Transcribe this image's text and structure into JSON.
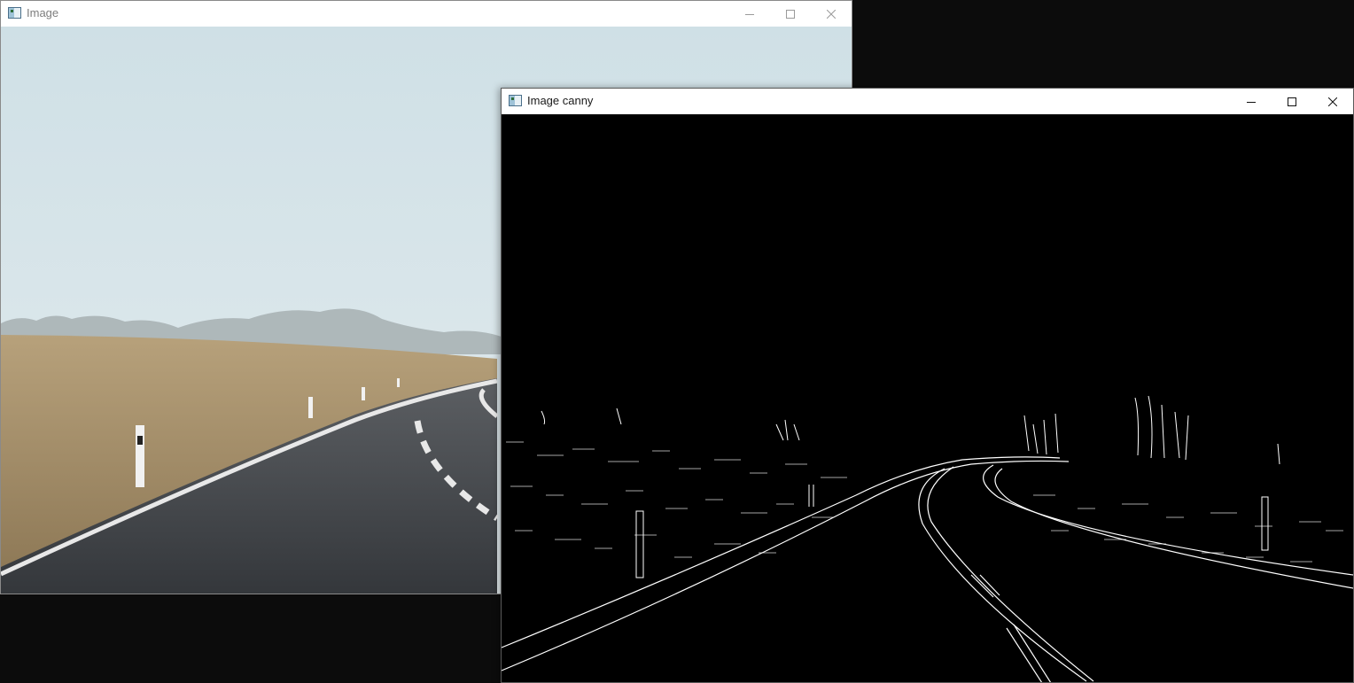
{
  "windows": {
    "original": {
      "title": "Image",
      "icon": "opencv-window-icon",
      "controls": [
        "minimize-icon",
        "maximize-icon",
        "close-icon"
      ]
    },
    "canny": {
      "title": "Image canny",
      "icon": "opencv-window-icon",
      "controls": [
        "minimize-icon",
        "maximize-icon",
        "close-icon"
      ]
    }
  },
  "colors": {
    "desktop": "#0c0c0c",
    "titlebar": "#ffffff",
    "canny_background": "#000000",
    "canny_edges": "#ffffff",
    "sky": "#d3e2e7",
    "field": "#a38d67",
    "asphalt": "#3d3f43"
  }
}
